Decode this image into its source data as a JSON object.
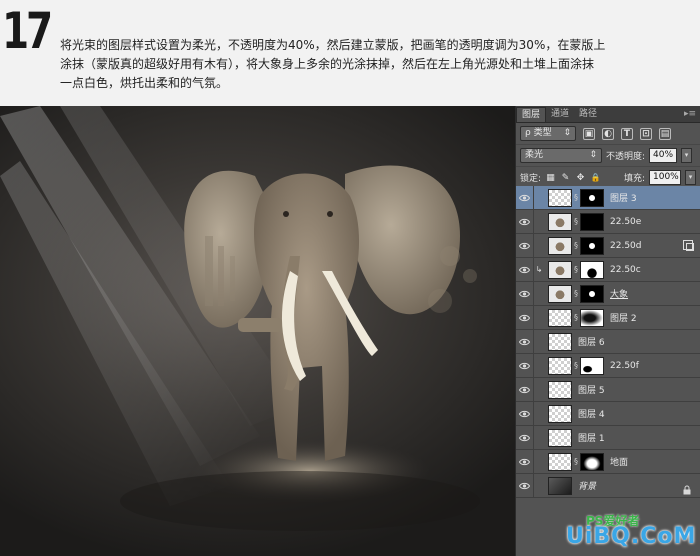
{
  "tutorial": {
    "step_number": "17",
    "line1": "将光束的图层样式设置为柔光，不透明度为40%，然后建立蒙版，把画笔的透明度调为30%，在蒙版上",
    "line2": "涂抹（蒙版真的超级好用有木有），将大象身上多余的光涂抹掉，然后在左上角光源处和土堆上面涂抹",
    "line3": "一点白色，烘托出柔和的气氛。"
  },
  "panel": {
    "tabs": [
      {
        "label": "图层",
        "active": true
      },
      {
        "label": "通道",
        "active": false
      },
      {
        "label": "路径",
        "active": false
      }
    ],
    "menu_glyph": "▸≡",
    "filter": {
      "label": "ρ 类型",
      "arrow": "⇕"
    },
    "filter_icons": [
      "▣",
      "◐",
      "T",
      "⊡",
      "▤"
    ],
    "blend_mode": {
      "value": "柔光",
      "arrow": "⇕"
    },
    "opacity": {
      "label": "不透明度:",
      "value": "40%",
      "arrow": "▾"
    },
    "lock": {
      "label": "锁定:",
      "icons": [
        "▦",
        "✎",
        "✥",
        "🔒"
      ]
    },
    "fill": {
      "label": "填充:",
      "value": "100%",
      "arrow": "▾"
    }
  },
  "layers": [
    {
      "name": "图层 3",
      "thumb": "checker",
      "mask": "black-blot",
      "selected": true,
      "chain": true,
      "clip": false
    },
    {
      "name": "22.50e",
      "thumb": "elephant",
      "mask": "black",
      "selected": false,
      "chain": true,
      "clip": false
    },
    {
      "name": "22.50d",
      "thumb": "elephant",
      "mask": "black-blot",
      "selected": false,
      "chain": true,
      "clip": false,
      "smart": true
    },
    {
      "name": "22.50c",
      "thumb": "elephant",
      "mask": "white-blot",
      "selected": false,
      "chain": true,
      "clip": true
    },
    {
      "name": "大象",
      "thumb": "elephant",
      "mask": "black-blot",
      "selected": false,
      "chain": true,
      "clip": false,
      "underline": true
    },
    {
      "name": "图层 2",
      "thumb": "checker",
      "mask": "soft",
      "selected": false,
      "chain": true,
      "clip": false
    },
    {
      "name": "图层 6",
      "thumb": "checker",
      "mask": null,
      "selected": false,
      "chain": false,
      "clip": false
    },
    {
      "name": "22.50f",
      "thumb": "checker",
      "mask": "small-blot",
      "selected": false,
      "chain": true,
      "clip": false
    },
    {
      "name": "图层 5",
      "thumb": "checker",
      "mask": null,
      "selected": false,
      "chain": false,
      "clip": false
    },
    {
      "name": "图层 4",
      "thumb": "checker",
      "mask": null,
      "selected": false,
      "chain": false,
      "clip": false
    },
    {
      "name": "图层 1",
      "thumb": "checker",
      "mask": null,
      "selected": false,
      "chain": false,
      "clip": false
    },
    {
      "name": "地面",
      "thumb": "checker",
      "mask": "ground",
      "selected": false,
      "chain": true,
      "clip": false
    },
    {
      "name": "背景",
      "thumb": "dark",
      "mask": null,
      "selected": false,
      "chain": false,
      "clip": false,
      "italic": true,
      "locked": true
    }
  ],
  "watermark": {
    "text": "UiBQ.CoM",
    "sub": "PS爱好者"
  },
  "colors": {
    "panel_bg": "#535353",
    "selected_layer": "#6b85a6",
    "watermark": "#3aa6e6"
  }
}
